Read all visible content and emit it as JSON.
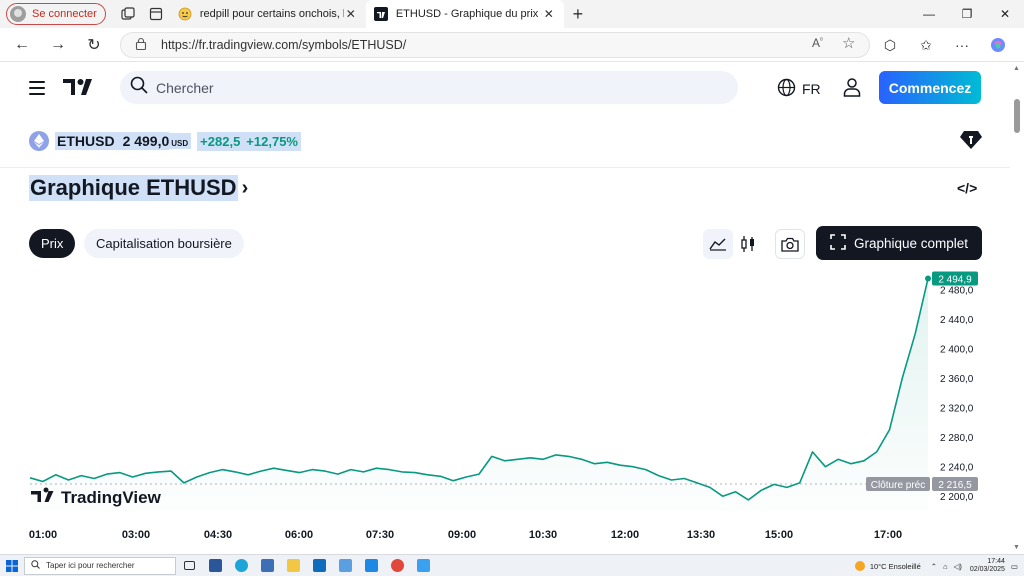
{
  "browser": {
    "profile_label": "Se connecter",
    "tabs": [
      {
        "label": "redpill pour certains onchois, la Fr",
        "active": false
      },
      {
        "label": "ETHUSD - Graphique du prix de l'",
        "active": true
      }
    ],
    "url": "https://fr.tradingview.com/symbols/ETHUSD/"
  },
  "header": {
    "search_placeholder": "Chercher",
    "language": "FR",
    "cta_label": "Commencez"
  },
  "ticker": {
    "symbol": "ETHUSD",
    "price": "2 499,0",
    "currency": "USD",
    "change_abs": "+282,5",
    "change_pct": "+12,75%",
    "up_color": "#089981"
  },
  "title": "Graphique ETHUSD",
  "tabs": {
    "price": "Prix",
    "market_cap": "Capitalisation boursière"
  },
  "full_chart_label": "Graphique complet",
  "chart_data": {
    "type": "area",
    "color": "#089981",
    "x_ticks": [
      "01:00",
      "03:00",
      "04:30",
      "06:00",
      "07:30",
      "09:00",
      "10:30",
      "12:00",
      "13:30",
      "15:00",
      "17:00"
    ],
    "y_ticks": [
      "2 200,0",
      "2 240,0",
      "2 280,0",
      "2 320,0",
      "2 360,0",
      "2 400,0",
      "2 440,0",
      "2 480,0"
    ],
    "ylim": [
      2180,
      2505
    ],
    "last_price_label": "2 494,9",
    "last_price": 2494.9,
    "prev_close_label": "Clôture préc",
    "prev_close_value": "2 216,5",
    "prev_close": 2216.5,
    "watermark": "TradingView",
    "series": [
      {
        "values": [
          2225,
          2220,
          2229,
          2222,
          2228,
          2224,
          2230,
          2232,
          2226,
          2231,
          2233,
          2234,
          2218,
          2226,
          2232,
          2236,
          2233,
          2229,
          2234,
          2238,
          2235,
          2232,
          2236,
          2234,
          2230,
          2236,
          2233,
          2238,
          2236,
          2233,
          2232,
          2229,
          2227,
          2221,
          2226,
          2230,
          2254,
          2248,
          2250,
          2252,
          2250,
          2256,
          2254,
          2250,
          2244,
          2246,
          2242,
          2240,
          2236,
          2228,
          2222,
          2224,
          2218,
          2212,
          2200,
          2206,
          2195,
          2208,
          2216,
          2212,
          2218,
          2260,
          2240,
          2250,
          2244,
          2248,
          2260,
          2290,
          2360,
          2420,
          2494.9
        ]
      }
    ]
  },
  "taskbar": {
    "search_placeholder": "Taper ici pour rechercher",
    "weather": "10°C  Ensoleillé",
    "time": "17:44",
    "date": "02/03/2025"
  }
}
